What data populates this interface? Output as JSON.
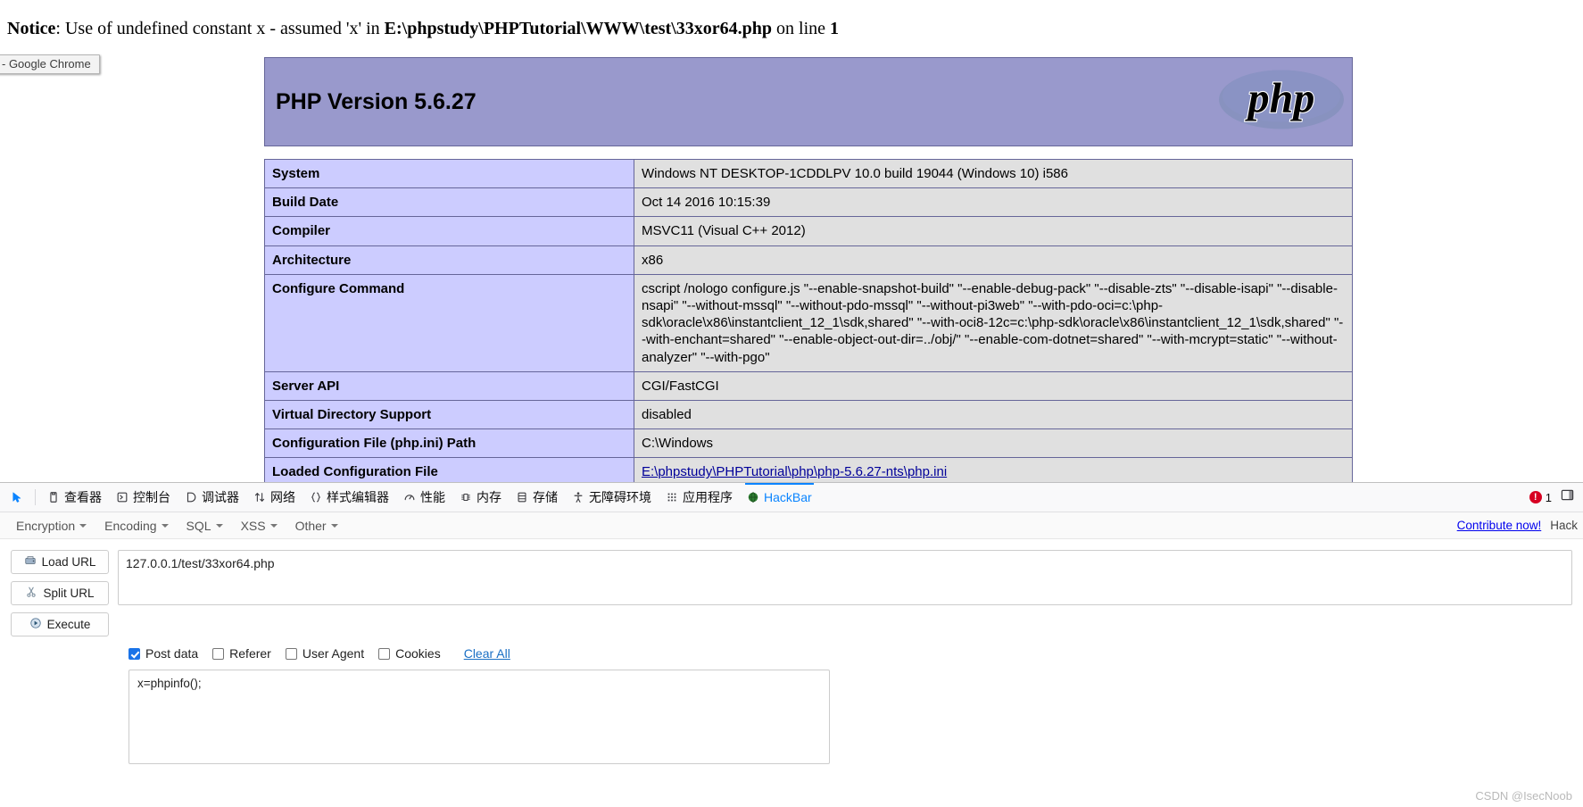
{
  "notice": {
    "label": "Notice",
    "text_before": ": Use of undefined constant x - assumed 'x' in ",
    "path": "E:\\phpstudy\\PHPTutorial\\WWW\\test\\33xor64.php",
    "text_mid": " on line ",
    "line": "1"
  },
  "tooltip": {
    "text": "- Google Chrome"
  },
  "phpinfo": {
    "version_title": "PHP Version 5.6.27",
    "logo_text": "php",
    "rows": [
      {
        "key": "System",
        "value": "Windows NT DESKTOP-1CDDLPV 10.0 build 19044 (Windows 10) i586"
      },
      {
        "key": "Build Date",
        "value": "Oct 14 2016 10:15:39"
      },
      {
        "key": "Compiler",
        "value": "MSVC11 (Visual C++ 2012)"
      },
      {
        "key": "Architecture",
        "value": "x86"
      },
      {
        "key": "Configure Command",
        "value": "cscript /nologo configure.js \"--enable-snapshot-build\" \"--enable-debug-pack\" \"--disable-zts\" \"--disable-isapi\" \"--disable-nsapi\" \"--without-mssql\" \"--without-pdo-mssql\" \"--without-pi3web\" \"--with-pdo-oci=c:\\php-sdk\\oracle\\x86\\instantclient_12_1\\sdk,shared\" \"--with-oci8-12c=c:\\php-sdk\\oracle\\x86\\instantclient_12_1\\sdk,shared\" \"--with-enchant=shared\" \"--enable-object-out-dir=../obj/\" \"--enable-com-dotnet=shared\" \"--with-mcrypt=static\" \"--without-analyzer\" \"--with-pgo\""
      },
      {
        "key": "Server API",
        "value": "CGI/FastCGI"
      },
      {
        "key": "Virtual Directory Support",
        "value": "disabled"
      },
      {
        "key": "Configuration File (php.ini) Path",
        "value": "C:\\Windows"
      },
      {
        "key": "Loaded Configuration File",
        "value": "E:\\phpstudy\\PHPTutorial\\php\\php-5.6.27-nts\\php.ini"
      }
    ]
  },
  "devtools": {
    "tabs": [
      {
        "id": "inspector",
        "label": "查看器",
        "icon": "inspector-icon",
        "active": false
      },
      {
        "id": "console",
        "label": "控制台",
        "icon": "console-icon",
        "active": false
      },
      {
        "id": "debugger",
        "label": "调试器",
        "icon": "debugger-icon",
        "active": false
      },
      {
        "id": "network",
        "label": "网络",
        "icon": "network-icon",
        "active": false
      },
      {
        "id": "style-editor",
        "label": "样式编辑器",
        "icon": "braces-icon",
        "active": false
      },
      {
        "id": "performance",
        "label": "性能",
        "icon": "gauge-icon",
        "active": false
      },
      {
        "id": "memory",
        "label": "内存",
        "icon": "memory-icon",
        "active": false
      },
      {
        "id": "storage",
        "label": "存储",
        "icon": "database-icon",
        "active": false
      },
      {
        "id": "accessibility",
        "label": "无障碍环境",
        "icon": "accessibility-icon",
        "active": false
      },
      {
        "id": "application",
        "label": "应用程序",
        "icon": "grid-icon",
        "active": false
      },
      {
        "id": "hackbar",
        "label": "HackBar",
        "icon": "hackbar-icon",
        "active": true
      }
    ],
    "error_count": "1",
    "picker_icon": "element-picker-icon",
    "dock_icon": "dock-panel-icon"
  },
  "hackbar": {
    "menus": [
      {
        "label": "Encryption"
      },
      {
        "label": "Encoding"
      },
      {
        "label": "SQL"
      },
      {
        "label": "XSS"
      },
      {
        "label": "Other"
      }
    ],
    "contribute_label": "Contribute now!",
    "right_extra": "Hack",
    "buttons": [
      {
        "id": "load-url",
        "label": "Load URL",
        "icon": "load-url-icon"
      },
      {
        "id": "split-url",
        "label": "Split URL",
        "icon": "scissors-icon"
      },
      {
        "id": "execute",
        "label": "Execute",
        "icon": "play-icon"
      }
    ],
    "url_value": "127.0.0.1/test/33xor64.php",
    "url_placeholder": "",
    "options": [
      {
        "id": "post-data",
        "label": "Post data",
        "checked": true
      },
      {
        "id": "referer",
        "label": "Referer",
        "checked": false
      },
      {
        "id": "user-agent",
        "label": "User Agent",
        "checked": false
      },
      {
        "id": "cookies",
        "label": "Cookies",
        "checked": false
      }
    ],
    "clear_all_label": "Clear All",
    "post_value": "x=phpinfo();",
    "post_placeholder": ""
  },
  "watermark": {
    "text": "CSDN @IsecNoob"
  },
  "colors": {
    "php_header_bg": "#9999cc",
    "key_bg": "#ccccff",
    "val_bg": "#e0e0e0",
    "accent": "#0a84ff",
    "link": "#1a6fc4",
    "error": "#d70022",
    "checkbox": "#1a73e8"
  }
}
